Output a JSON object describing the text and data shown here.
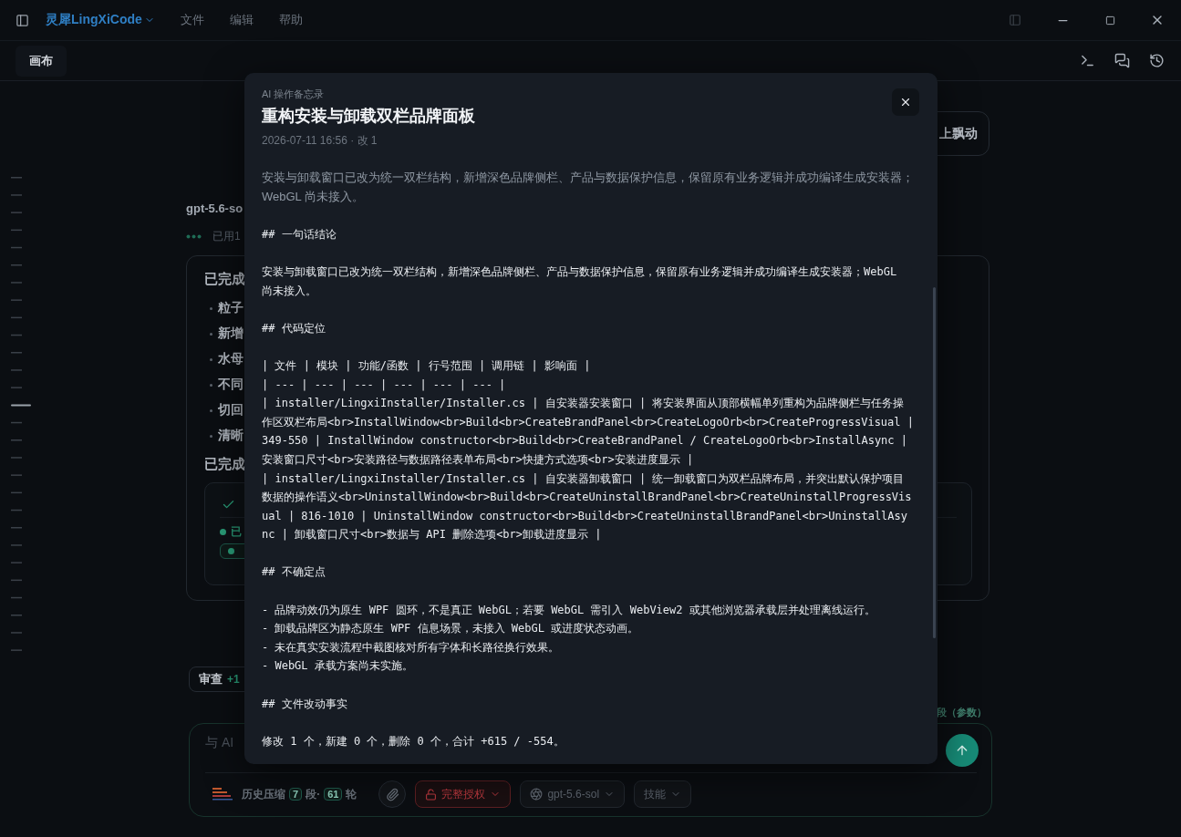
{
  "titlebar": {
    "app_name": "灵犀LingXiCode",
    "menus": [
      "文件",
      "编辑",
      "帮助"
    ]
  },
  "tabs": [
    {
      "label": "画布",
      "selected": true
    }
  ],
  "conversation": {
    "float_button": "上飘动",
    "model_name": "gpt-5.6-so",
    "status": "已用1",
    "card": {
      "title": "已完成",
      "bullets": [
        "粒子",
        "新增",
        "水母",
        "不同",
        "切回",
        "清晰"
      ],
      "second_title": "已完成",
      "result": {
        "status": "已"
      }
    },
    "review": {
      "label": "审查",
      "delta": "+1"
    }
  },
  "composer": {
    "hint": "段（参数）",
    "placeholder": "与 AI",
    "history": {
      "label": "历史压缩",
      "segments": "7",
      "segments_unit": "段·",
      "rounds": "61",
      "rounds_unit": "轮"
    },
    "permission": "完整授权",
    "model": "gpt-5.6-sol",
    "skills": "技能"
  },
  "modal": {
    "kicker": "AI 操作备忘录",
    "title": "重构安装与卸载双栏品牌面板",
    "meta": "2026-07-11 16:56 · 改 1",
    "blocks": [
      {
        "kind": "summary",
        "lines": [
          "安装与卸载窗口已改为统一双栏结构，新增深色品牌侧栏、产品与数据保护信息，保留原有业务逻辑并成功编译生成安装器；WebGL 尚未接入。"
        ]
      },
      {
        "kind": "code",
        "lines": [
          "## 一句话结论"
        ]
      },
      {
        "kind": "code",
        "lines": [
          "安装与卸载窗口已改为统一双栏结构，新增深色品牌侧栏、产品与数据保护信息，保留原有业务逻辑并成功编译生成安装器；WebGL 尚未接入。"
        ]
      },
      {
        "kind": "code",
        "lines": [
          "## 代码定位"
        ]
      },
      {
        "kind": "code",
        "lines": [
          "| 文件 | 模块 | 功能/函数 | 行号范围 | 调用链 | 影响面 |",
          "| --- | --- | --- | --- | --- | --- |",
          "| installer/LingxiInstaller/Installer.cs | 自安装器安装窗口 | 将安装界面从顶部横幅单列重构为品牌侧栏与任务操作区双栏布局<br>InstallWindow<br>Build<br>CreateBrandPanel<br>CreateLogoOrb<br>CreateProgressVisual | 349-550 | InstallWindow constructor<br>Build<br>CreateBrandPanel / CreateLogoOrb<br>InstallAsync | 安装窗口尺寸<br>安装路径与数据路径表单布局<br>快捷方式选项<br>安装进度显示 |",
          "| installer/LingxiInstaller/Installer.cs | 自安装器卸载窗口 | 统一卸载窗口为双栏品牌布局，并突出默认保护项目数据的操作语义<br>UninstallWindow<br>Build<br>CreateUninstallBrandPanel<br>CreateUninstallProgressVisual | 816-1010 | UninstallWindow constructor<br>Build<br>CreateUninstallBrandPanel<br>UninstallAsync | 卸载窗口尺寸<br>数据与 API 删除选项<br>卸载进度显示 |"
        ]
      },
      {
        "kind": "code",
        "lines": [
          "## 不确定点"
        ]
      },
      {
        "kind": "code",
        "lines": [
          "- 品牌动效仍为原生 WPF 圆环，不是真正 WebGL；若要 WebGL 需引入 WebView2 或其他浏览器承载层并处理离线运行。",
          "- 卸载品牌区为静态原生 WPF 信息场景，未接入 WebGL 或进度状态动画。",
          "- 未在真实安装流程中截图核对所有字体和长路径换行效果。",
          "- WebGL 承载方案尚未实施。"
        ]
      },
      {
        "kind": "code",
        "lines": [
          "## 文件改动事实"
        ]
      },
      {
        "kind": "code",
        "lines": [
          "修改 1 个，新建 0 个，删除 0 个，合计 +615 / -554。"
        ]
      }
    ]
  }
}
